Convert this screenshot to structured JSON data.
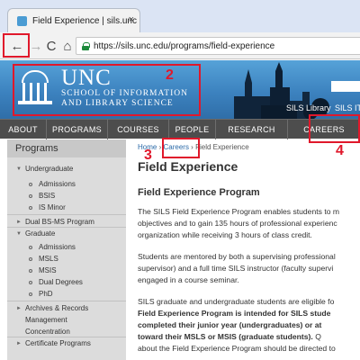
{
  "browser": {
    "tab_title": "Field Experience | sils.unc",
    "tab_close": "×",
    "address": "https://sils.unc.edu/programs/field-experience",
    "back_glyph": "←",
    "forward_glyph": "→",
    "reload_glyph": "C",
    "home_glyph": "⌂"
  },
  "header": {
    "logo_unc": "UNC",
    "logo_line1": "SCHOOL OF INFORMATION",
    "logo_line2": "AND LIBRARY SCIENCE",
    "sils_library": "SILS Library",
    "sils_it": "SILS IT"
  },
  "nav": {
    "items": [
      "ABOUT",
      "PROGRAMS",
      "COURSES",
      "PEOPLE",
      "RESEARCH",
      "CAREERS"
    ]
  },
  "sidebar": {
    "title": "Programs",
    "items": [
      {
        "label": "Undergraduate",
        "level": 0,
        "expanded": true
      },
      {
        "label": "Admissions",
        "level": 1
      },
      {
        "label": "BSIS",
        "level": 1
      },
      {
        "label": "IS Minor",
        "level": 1
      },
      {
        "label": "Dual BS-MS Program",
        "level": 0,
        "expanded": false
      },
      {
        "label": "Graduate",
        "level": 0,
        "expanded": true
      },
      {
        "label": "Admissions",
        "level": 1
      },
      {
        "label": "MSLS",
        "level": 1
      },
      {
        "label": "MSIS",
        "level": 1
      },
      {
        "label": "Dual Degrees",
        "level": 1
      },
      {
        "label": "PhD",
        "level": 1
      },
      {
        "label": "Archives & Records",
        "level": 0,
        "expanded": false
      },
      {
        "label": "Management",
        "level": 0
      },
      {
        "label": "Concentration",
        "level": 0
      },
      {
        "label": "Certificate Programs",
        "level": 0,
        "expanded": false
      }
    ]
  },
  "content": {
    "breadcrumb": {
      "home": "Home",
      "sep": "›",
      "careers": "Careers",
      "current": "Field Experience"
    },
    "title": "Field Experience",
    "subheading": "Field Experience Program",
    "para1": [
      "The SILS Field Experience Program enables students to m",
      "objectives and to gain 135 hours of professional experienc",
      "organization while receiving 3 hours of class credit."
    ],
    "para2": [
      "Students are mentored by both a supervising professional",
      "supervisor) and a full time SILS instructor (faculty supervi",
      "engaged in a course seminar."
    ],
    "para3_line1": "SILS graduate and undergraduate students are eligible fo",
    "para3_bold": [
      "Field Experience Program is intended for SILS stude",
      "completed their junior year (undergraduates) or at",
      "toward their MSLS or MSIS (graduate students)."
    ],
    "para3_tail": " Q",
    "para3_last": "about the Field Experience Program should be directed to"
  },
  "annotations": {
    "n2": "2",
    "n3": "3",
    "n4": "4",
    "color": "#e0182b"
  }
}
